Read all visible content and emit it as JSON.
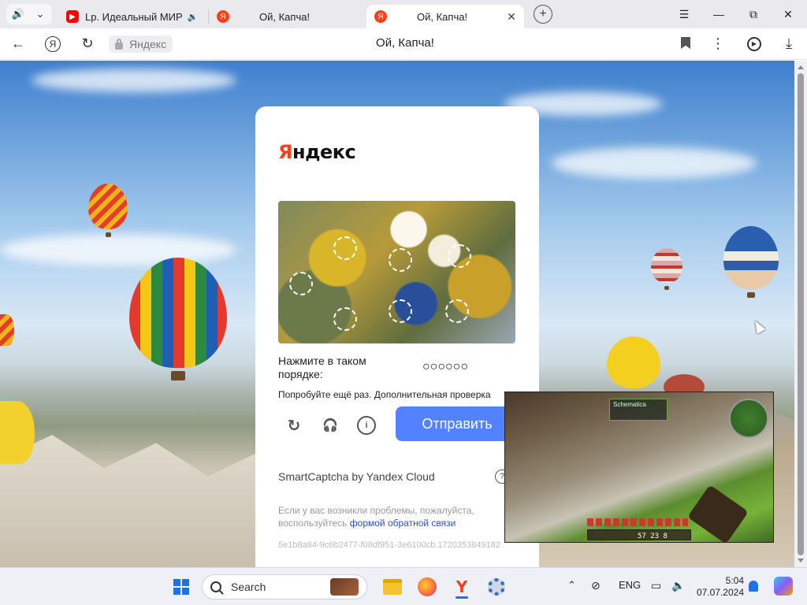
{
  "browser": {
    "tabs": [
      {
        "title": "Lp. Идеальный МИР",
        "favicon": "youtube-icon",
        "audio": "speaker-icon"
      },
      {
        "title": "Ой, Капча!",
        "favicon": "yandex-icon"
      },
      {
        "title": "Ой, Капча!",
        "favicon": "yandex-icon",
        "active": true
      }
    ],
    "new_tab": "+",
    "address": {
      "site_chip": "Яндекс",
      "page_title": "Ой, Капча!"
    },
    "window_controls": {
      "menu": "☰",
      "minimize": "—",
      "restore": "⧉",
      "close": "✕"
    }
  },
  "captcha": {
    "logo_first": "Я",
    "logo_rest": "ндекс",
    "instruction": "Нажмите в таком порядке:",
    "icon_sequence": "○○○○○○",
    "error": "Попробуйте ещё раз. Дополнительная проверка",
    "refresh_icon": "↻",
    "audio_icon": "🎧",
    "info_icon": "i",
    "submit_label": "Отправить",
    "brand": "SmartCaptcha by Yandex Cloud",
    "help_icon": "?",
    "help_text_prefix": "Если у вас возникли проблемы, пожалуйста, воспользуйтесь ",
    "help_link": "формой обратной связи",
    "token": "5e1b8a84-9c6b2477-f08df951-3e6100cb.1720353849182"
  },
  "pip": {
    "hud_label": "Schematica",
    "hud_nums": "57  23   8"
  },
  "taskbar": {
    "search_placeholder": "Search",
    "language": "ENG",
    "time": "5:04",
    "date": "07.07.2024"
  },
  "colors": {
    "yandex_red": "#fc3f1d",
    "submit_blue": "#5282ff",
    "link_blue": "#2a4fbf"
  }
}
